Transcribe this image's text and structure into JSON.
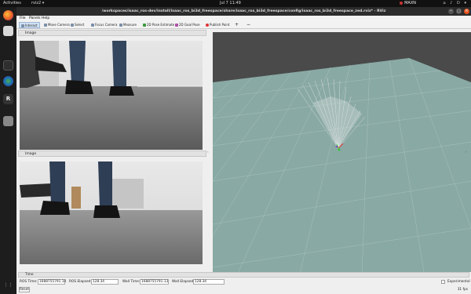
{
  "topbar": {
    "activities": "Activities",
    "app_name": "rviz2 ▾",
    "clock": "Jul 7  11:49",
    "power_mode": "MAXN",
    "tray": "⌂ ♪ ⏻ ▾"
  },
  "window": {
    "title": "/workspaces/isaac_ros-dev/install/isaac_ros_bi3d_freespace/share/isaac_ros_bi3d_freespace/config/isaac_ros_bi3d_freespace_zed.rviz* - RViz"
  },
  "menu": [
    "File",
    "Panels",
    "Help"
  ],
  "toolbar": {
    "interact": "Interact",
    "move_camera": "Move Camera",
    "select": "Select",
    "focus_camera": "Focus Camera",
    "measure": "Measure",
    "pose_estimate": "2D Pose Estimate",
    "goal_pose": "2D Goal Pose",
    "publish_point": "Publish Point",
    "plus": "+",
    "minus": "−"
  },
  "panels": {
    "image_top_title": "Image",
    "image_bottom_title": "Image"
  },
  "time": {
    "title": "Time",
    "ros_time_label": "ROS Time:",
    "ros_time_value": "1688755791.10",
    "ros_elapsed_label": "ROS Elapsed:",
    "ros_elapsed_value": "128.34",
    "wall_time_label": "Wall Time:",
    "wall_time_value": "1688755791.13",
    "wall_elapsed_label": "Wall Elapsed:",
    "wall_elapsed_value": "128.34",
    "experimental_label": "Experimental",
    "reset_label": "Reset",
    "fps": "31 fps"
  },
  "colors": {
    "grid_plane": "#89a9a4",
    "grid_lines": "#a9c2be",
    "background_3d": "#4a4a4a",
    "freespace_rays": "#e8e8e8"
  }
}
